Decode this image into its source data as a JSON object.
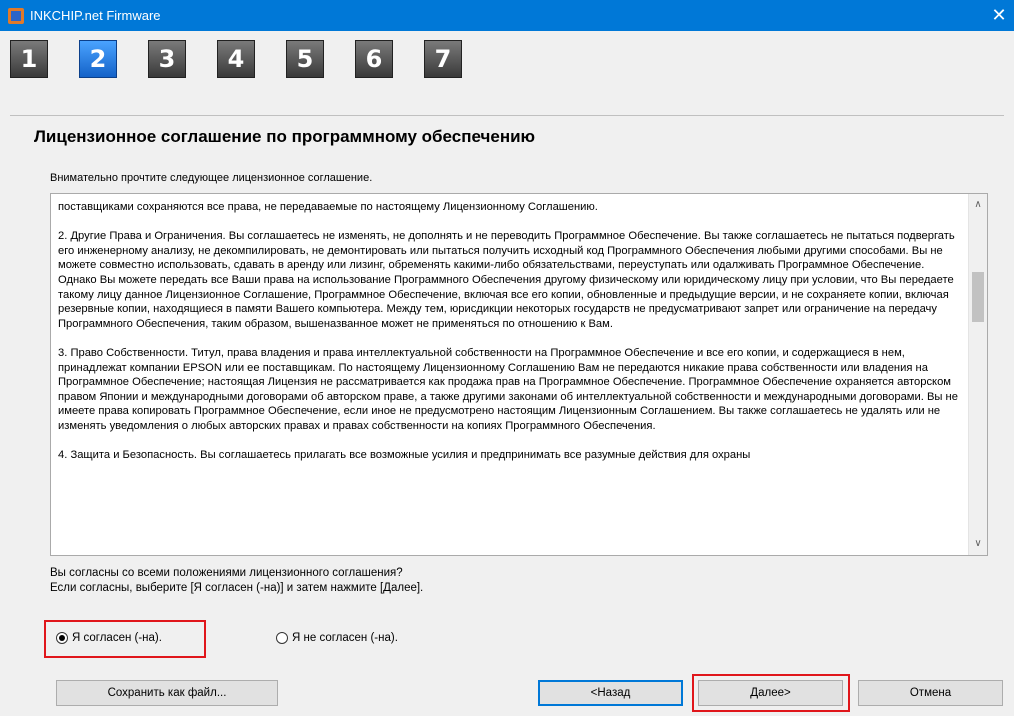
{
  "window": {
    "title": "INKCHIP.net Firmware",
    "close_glyph": "✕"
  },
  "steps": [
    {
      "label": "1",
      "active": false
    },
    {
      "label": "2",
      "active": true
    },
    {
      "label": "3",
      "active": false
    },
    {
      "label": "4",
      "active": false
    },
    {
      "label": "5",
      "active": false
    },
    {
      "label": "6",
      "active": false
    },
    {
      "label": "7",
      "active": false
    }
  ],
  "page": {
    "heading": "Лицензионное соглашение по программному обеспечению",
    "intro": "Внимательно прочтите следующее лицензионное соглашение."
  },
  "license": {
    "text": "поставщиками сохраняются все права, не передаваемые по настоящему Лицензионному Соглашению.\n\n2. Другие Права и Ограничения. Вы соглашаетесь не изменять, не дополнять и не переводить Программное Обеспечение. Вы также соглашаетесь не пытаться подвергать его инженерному анализу, не декомпилировать, не демонтировать или пытаться получить исходный код Программного Обеспечения любыми другими способами. Вы не можете совместно использовать, сдавать в аренду или лизинг, обременять какими-либо обязательствами, переуступать или одалживать Программное Обеспечение. Однако Вы можете передать все Ваши права на использование Программного Обеспечения другому физическому или юридическому лицу при условии, что Вы передаете такому лицу данное Лицензионное Соглашение, Программное Обеспечение, включая все его копии, обновленные и предыдущие версии, и не сохраняете копии, включая резервные копии, находящиеся в памяти Вашего компьютера. Между тем, юрисдикции некоторых государств не предусматривают запрет или ограничение на передачу Программного Обеспечения, таким образом, вышеназванное может не применяться по отношению к Вам.\n\n3. Право Собственности. Титул, права владения и права интеллектуальной собственности на Программное Обеспечение и все его копии, и содержащиеся в нем, принадлежат компании EPSON или ее поставщикам. По настоящему Лицензионному Соглашению Вам не передаются никакие права собственности или владения на Программное Обеспечение; настоящая Лицензия не рассматривается как продажа прав на Программное Обеспечение. Программное Обеспечение охраняется авторском правом Японии и международными договорами об авторском праве, а также другими законами об интеллектуальной собственности и международными договорами. Вы не имеете права копировать Программное Обеспечение, если иное не предусмотрено настоящим Лицензионным Соглашением. Вы также соглашаетесь не удалять или не изменять уведомления о любых авторских правах и правах собственности на копиях Программного Обеспечения.\n\n4. Защита и Безопасность. Вы соглашаетесь прилагать все возможные усилия и предпринимать все разумные действия для охраны",
    "scroll_up_glyph": "∧",
    "scroll_down_glyph": "∨"
  },
  "question": {
    "line1": "Вы согласны со всеми положениями лицензионного соглашения?",
    "line2": "Если согласны, выберите [Я согласен (-на)] и затем нажмите [Далее]."
  },
  "options": {
    "agree": {
      "label": "Я согласен (-на).",
      "checked": true
    },
    "disagree": {
      "label": "Я не согласен (-на).",
      "checked": false
    }
  },
  "buttons": {
    "save": "Сохранить как файл...",
    "back": "<Назад",
    "next": "Далее>",
    "cancel": "Отмена"
  },
  "colors": {
    "accent": "#0078d7",
    "highlight": "#e0161b"
  }
}
